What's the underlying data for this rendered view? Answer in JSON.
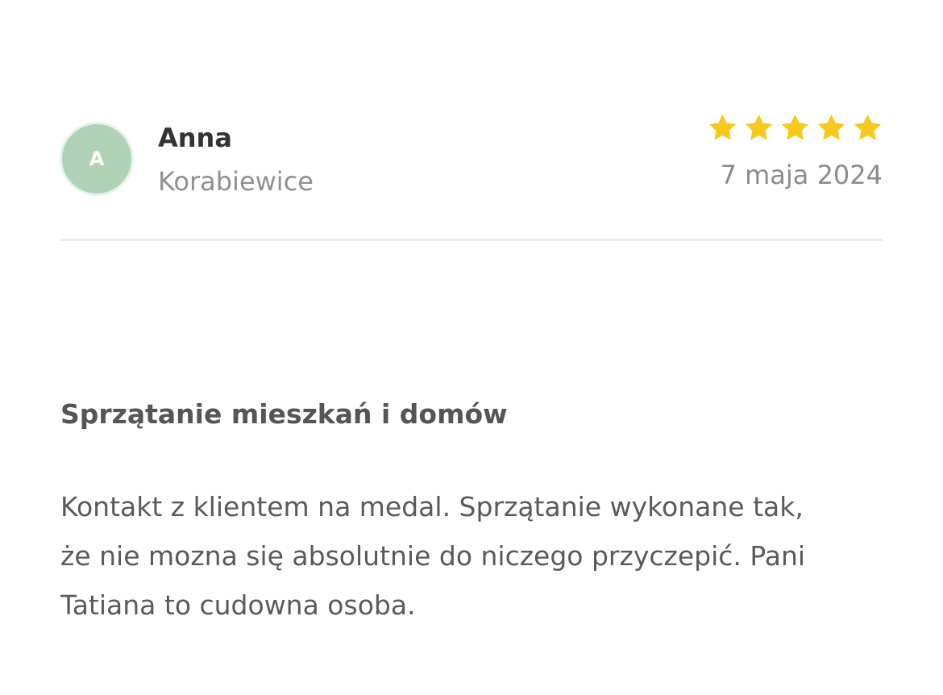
{
  "review": {
    "author": {
      "initial": "A",
      "name": "Anna",
      "location": "Korabiewice",
      "avatar_color": "#b0d3b8"
    },
    "rating": {
      "value": 5,
      "max": 5,
      "star_color": "#f7c81e",
      "icon": "star-icon"
    },
    "date": "7 maja 2024",
    "service": "Sprzątanie mieszkań i domów",
    "text_lines": [
      "Kontakt z klientem na medal. Sprzątanie wykonane tak,",
      "że nie mozna się absolutnie do niczego przyczepić. Pani",
      "Tatiana to cudowna osoba."
    ]
  }
}
